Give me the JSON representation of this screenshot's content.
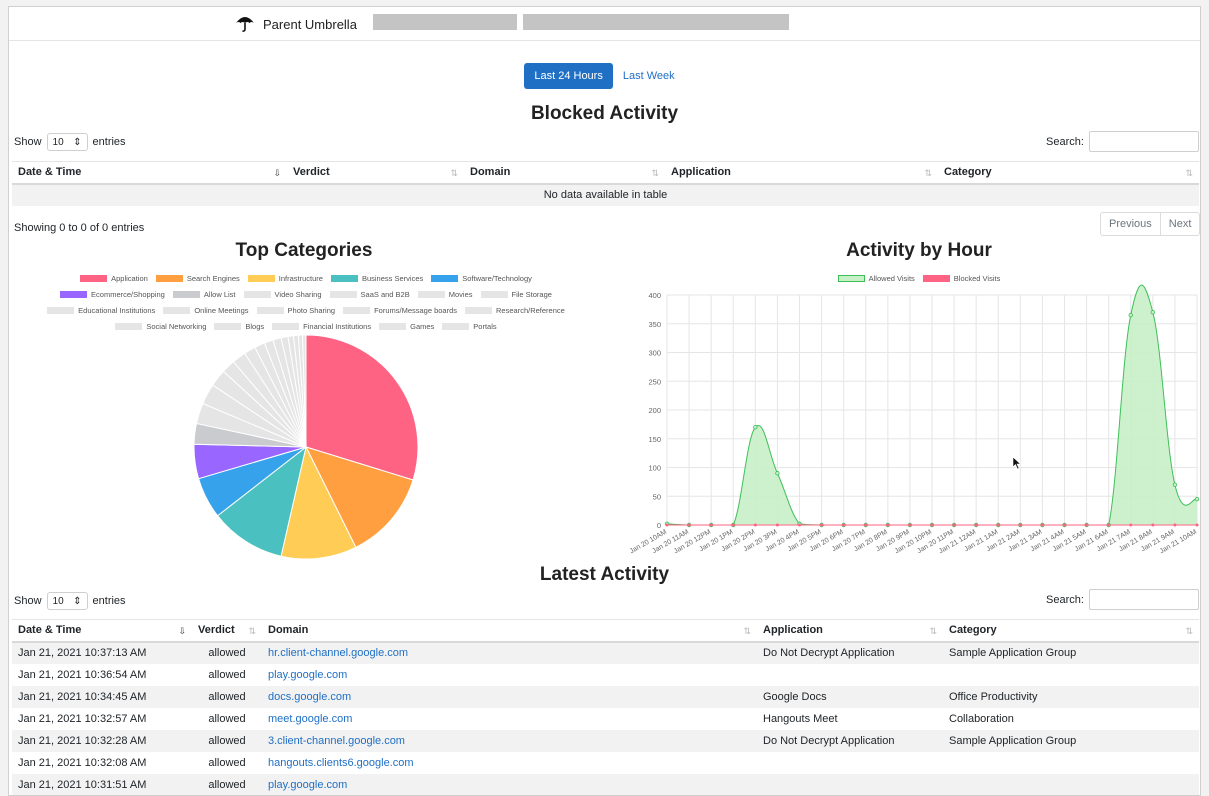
{
  "header": {
    "brand": "Parent Umbrella",
    "logo_icon": "umbrella-icon"
  },
  "range_toggle": {
    "active": "Last 24 Hours",
    "inactive": "Last Week"
  },
  "blocked": {
    "title": "Blocked Activity",
    "show_label": "Show",
    "entries_value": "10",
    "entries_label": "entries",
    "search_label": "Search:",
    "columns": [
      "Date & Time",
      "Verdict",
      "Domain",
      "Application",
      "Category"
    ],
    "empty_text": "No data available in table",
    "info": "Showing 0 to 0 of 0 entries",
    "pager": {
      "previous": "Previous",
      "next": "Next"
    }
  },
  "colors": {
    "accent": "#1f6fc5",
    "allowed_fill": "#c6f0c6",
    "allowed_line": "#3fbf5a",
    "blocked": "#ff6384"
  },
  "chart_data": [
    {
      "type": "pie",
      "title": "Top Categories",
      "categories": [
        "Application",
        "Search Engines",
        "Infrastructure",
        "Business Services",
        "Software/Technology",
        "Ecommerce/Shopping",
        "Allow List",
        "Video Sharing",
        "SaaS and B2B",
        "Movies",
        "File Storage",
        "Educational Institutions",
        "Online Meetings",
        "Photo Sharing",
        "Forums/Message boards",
        "Research/Reference",
        "Social Networking",
        "Blogs",
        "Financial Institutions",
        "Games",
        "Portals"
      ],
      "values": [
        30,
        13,
        11,
        11,
        6,
        5,
        3,
        3,
        3,
        2.5,
        2,
        2,
        1.7,
        1.5,
        1.3,
        1.2,
        1,
        0.8,
        0.7,
        0.6,
        0.5
      ],
      "colors": [
        "#ff6384",
        "#ff9f40",
        "#ffcd56",
        "#4bc0c0",
        "#36a2eb",
        "#9966ff",
        "#c9cbcf",
        "#e5e5e5",
        "#e5e5e5",
        "#e5e5e5",
        "#e5e5e5",
        "#e5e5e5",
        "#e5e5e5",
        "#e5e5e5",
        "#e5e5e5",
        "#e5e5e5",
        "#e5e5e5",
        "#e5e5e5",
        "#e5e5e5",
        "#e5e5e5",
        "#e5e5e5"
      ],
      "legend_position": "top"
    },
    {
      "type": "area",
      "title": "Activity by Hour",
      "x": [
        "Jan 20 10AM",
        "Jan 20 11AM",
        "Jan 20 12PM",
        "Jan 20 1PM",
        "Jan 20 2PM",
        "Jan 20 3PM",
        "Jan 20 4PM",
        "Jan 20 5PM",
        "Jan 20 6PM",
        "Jan 20 7PM",
        "Jan 20 8PM",
        "Jan 20 9PM",
        "Jan 20 10PM",
        "Jan 20 11PM",
        "Jan 21 12AM",
        "Jan 21 1AM",
        "Jan 21 2AM",
        "Jan 21 3AM",
        "Jan 21 4AM",
        "Jan 21 5AM",
        "Jan 21 6AM",
        "Jan 21 7AM",
        "Jan 21 8AM",
        "Jan 21 9AM",
        "Jan 21 10AM"
      ],
      "series": [
        {
          "name": "Allowed Visits",
          "values": [
            2,
            0,
            0,
            0,
            170,
            90,
            2,
            0,
            0,
            0,
            0,
            0,
            0,
            0,
            0,
            0,
            0,
            0,
            0,
            0,
            0,
            365,
            370,
            70,
            45
          ]
        },
        {
          "name": "Blocked Visits",
          "values": [
            0,
            0,
            0,
            0,
            0,
            0,
            0,
            0,
            0,
            0,
            0,
            0,
            0,
            0,
            0,
            0,
            0,
            0,
            0,
            0,
            0,
            0,
            0,
            0,
            0
          ]
        }
      ],
      "ylim": [
        0,
        400
      ],
      "yticks": [
        0,
        50,
        100,
        150,
        200,
        250,
        300,
        350,
        400
      ],
      "grid": true,
      "legend_position": "top"
    }
  ],
  "latest": {
    "title": "Latest Activity",
    "show_label": "Show",
    "entries_value": "10",
    "entries_label": "entries",
    "search_label": "Search:",
    "columns": [
      "Date & Time",
      "Verdict",
      "Domain",
      "Application",
      "Category"
    ],
    "rows": [
      [
        "Jan 21, 2021 10:37:13 AM",
        "allowed",
        "hr.client-channel.google.com",
        "Do Not Decrypt Application",
        "Sample Application Group"
      ],
      [
        "Jan 21, 2021 10:36:54 AM",
        "allowed",
        "play.google.com",
        "",
        ""
      ],
      [
        "Jan 21, 2021 10:34:45 AM",
        "allowed",
        "docs.google.com",
        "Google Docs",
        "Office Productivity"
      ],
      [
        "Jan 21, 2021 10:32:57 AM",
        "allowed",
        "meet.google.com",
        "Hangouts Meet",
        "Collaboration"
      ],
      [
        "Jan 21, 2021 10:32:28 AM",
        "allowed",
        "3.client-channel.google.com",
        "Do Not Decrypt Application",
        "Sample Application Group"
      ],
      [
        "Jan 21, 2021 10:32:08 AM",
        "allowed",
        "hangouts.clients6.google.com",
        "",
        ""
      ],
      [
        "Jan 21, 2021 10:31:51 AM",
        "allowed",
        "play.google.com",
        "",
        ""
      ]
    ]
  }
}
